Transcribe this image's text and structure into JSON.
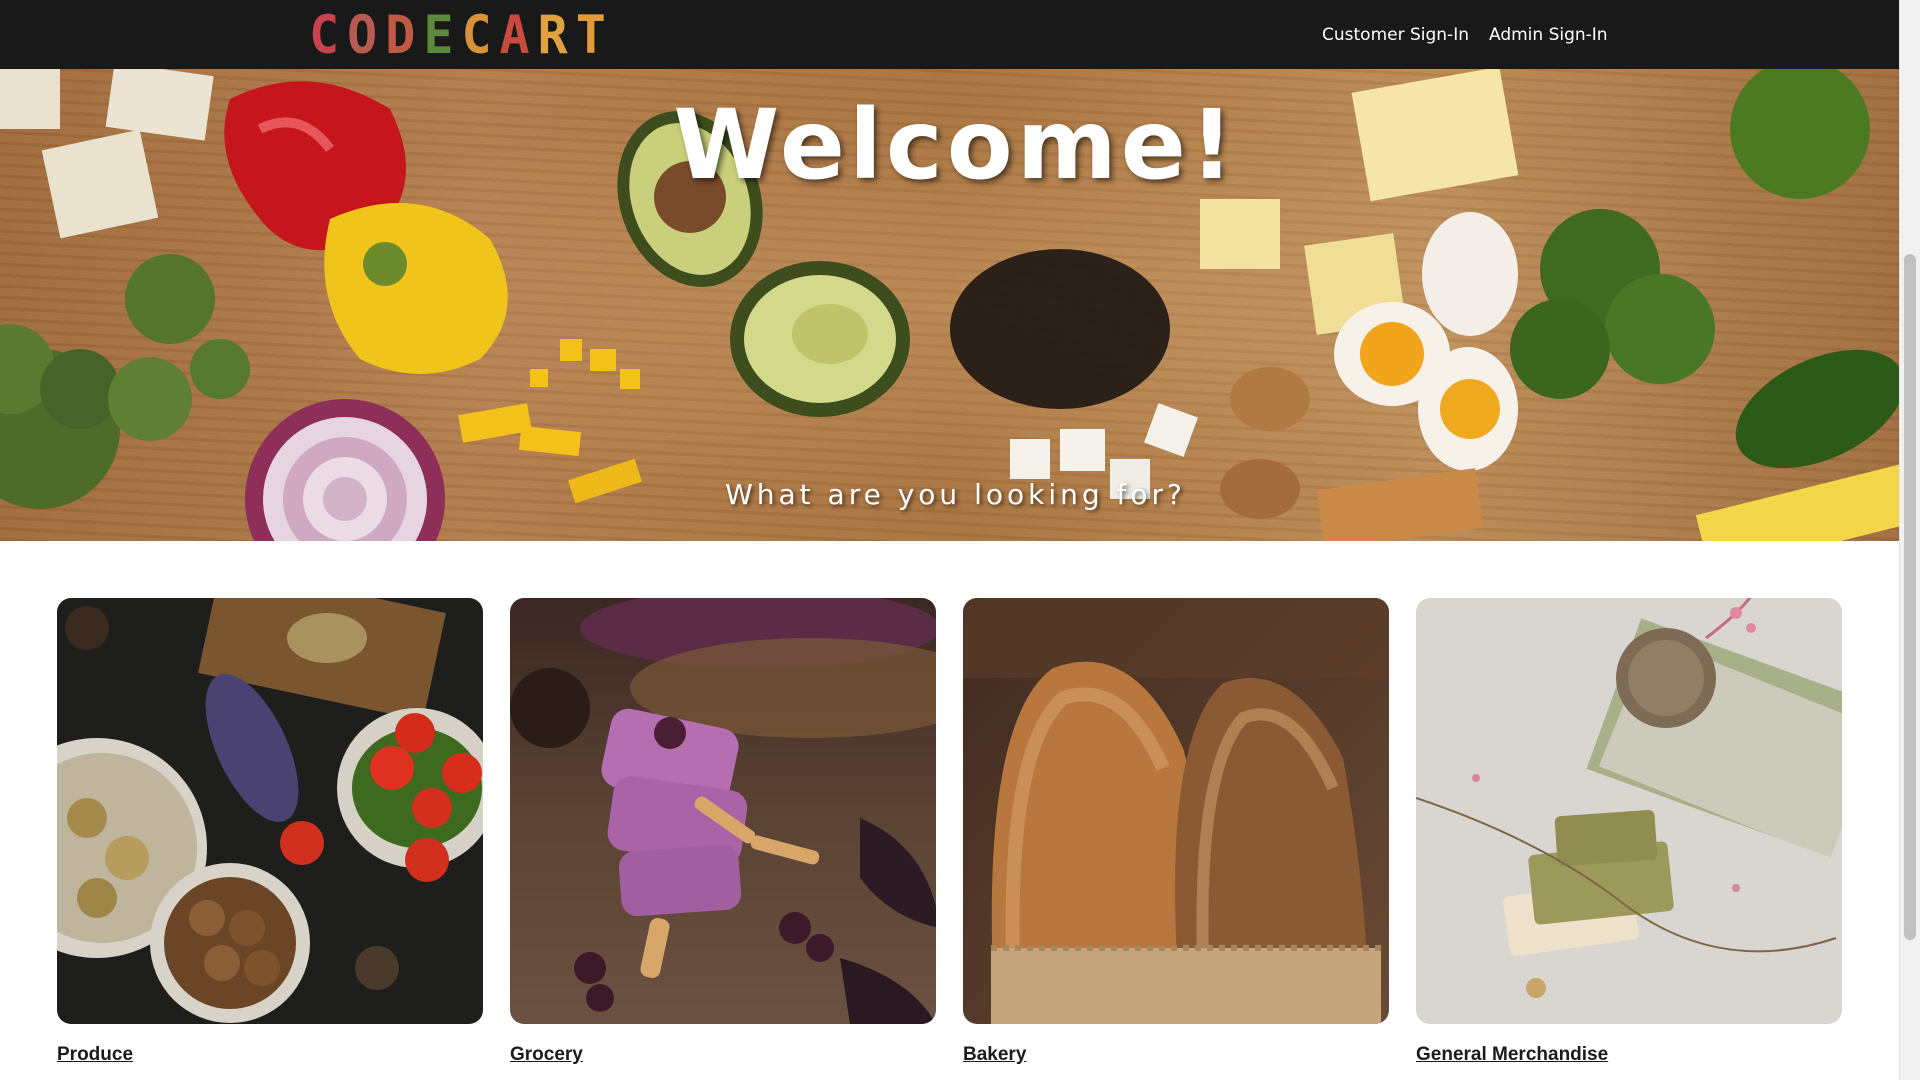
{
  "header": {
    "brand_letters": [
      {
        "char": "C",
        "color": "#c9414e"
      },
      {
        "char": "O",
        "color": "#b85a52"
      },
      {
        "char": "D",
        "color": "#c15a44"
      },
      {
        "char": "E",
        "color": "#5c8a3c"
      },
      {
        "char": "C",
        "color": "#d8923a"
      },
      {
        "char": "A",
        "color": "#c94a3e"
      },
      {
        "char": "R",
        "color": "#e0a23e"
      },
      {
        "char": "T",
        "color": "#e39a3a"
      }
    ],
    "nav": {
      "customer_signin": "Customer Sign-In",
      "admin_signin": "Admin Sign-In"
    }
  },
  "hero": {
    "title": "Welcome!",
    "subtitle": "What are you looking for?"
  },
  "categories": [
    {
      "label": "Produce"
    },
    {
      "label": "Grocery"
    },
    {
      "label": "Bakery"
    },
    {
      "label": "General Merchandise"
    }
  ],
  "colors": {
    "navbar_bg": "#1a1919",
    "nav_text": "#ffffff",
    "category_link": "#1b1b1b"
  }
}
